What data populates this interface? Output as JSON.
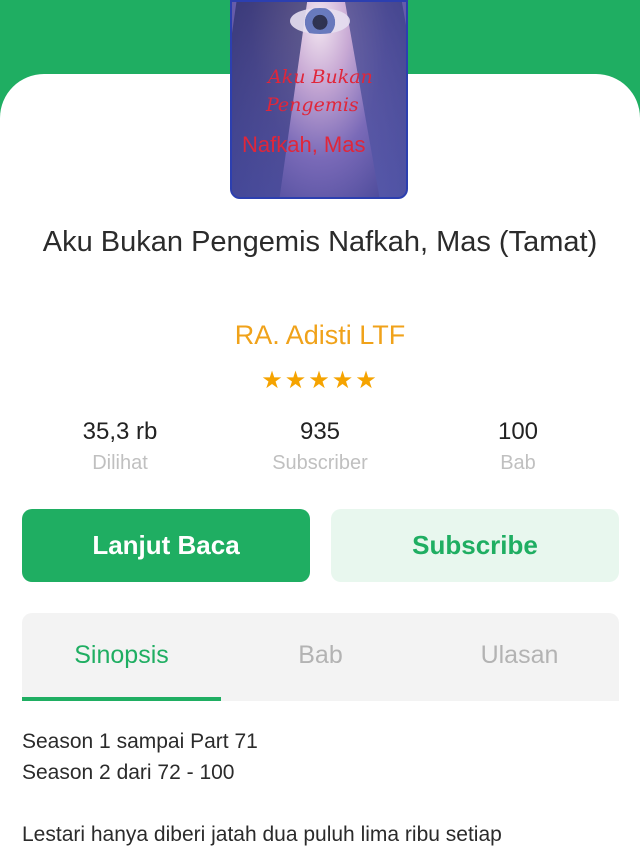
{
  "book": {
    "cover_text": {
      "line1": "Aku Bukan",
      "line2": "Pengemis",
      "line3": "Nafkah, Mas"
    },
    "title": "Aku Bukan Pengemis Nafkah, Mas (Tamat)",
    "author": "RA. Adisti LTF",
    "rating_stars": "★★★★★",
    "rating": 5
  },
  "stats": [
    {
      "value": "35,3 rb",
      "label": "Dilihat"
    },
    {
      "value": "935",
      "label": "Subscriber"
    },
    {
      "value": "100",
      "label": "Bab"
    }
  ],
  "actions": {
    "read_label": "Lanjut Baca",
    "subscribe_label": "Subscribe"
  },
  "tabs": [
    {
      "label": "Sinopsis",
      "active": true
    },
    {
      "label": "Bab",
      "active": false
    },
    {
      "label": "Ulasan",
      "active": false
    }
  ],
  "synopsis": {
    "lines": [
      "Season 1 sampai Part 71",
      "Season 2 dari 72 - 100",
      "Lestari hanya diberi jatah dua puluh lima ribu setiap"
    ]
  },
  "colors": {
    "accent": "#1fae62",
    "author": "#f0a21a",
    "star": "#f5a300",
    "muted": "#c0c0c0"
  }
}
